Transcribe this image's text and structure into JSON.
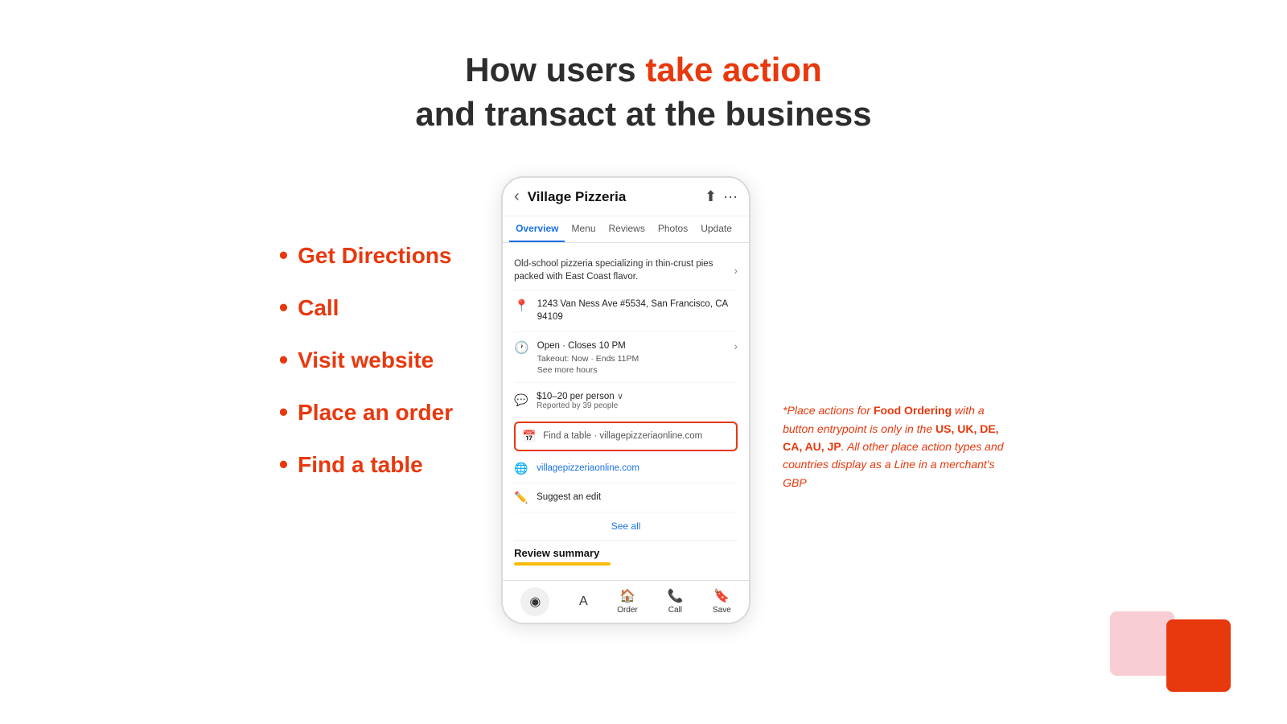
{
  "header": {
    "line1_normal": "How users ",
    "line1_accent": "take action",
    "line2": "and transact at the business"
  },
  "bullets": {
    "items": [
      {
        "label": "Get Directions"
      },
      {
        "label": "Call"
      },
      {
        "label": "Visit website"
      },
      {
        "label": "Place an order"
      },
      {
        "label": "Find a table"
      }
    ]
  },
  "phone": {
    "topbar": {
      "title": "Village Pizzeria",
      "back_icon": "‹",
      "share_icon": "⬆",
      "more_icon": "···"
    },
    "nav_tabs": [
      {
        "label": "Overview",
        "active": true
      },
      {
        "label": "Menu",
        "active": false
      },
      {
        "label": "Reviews",
        "active": false
      },
      {
        "label": "Photos",
        "active": false
      },
      {
        "label": "Update",
        "active": false
      }
    ],
    "description": "Old-school pizzeria specializing in thin-crust pies packed with East Coast flavor.",
    "address": "1243 Van Ness Ave #5534, San Francisco, CA 94109",
    "hours_main": "Open · Closes 10 PM",
    "hours_sub": "Takeout: Now · Ends 11PM",
    "hours_more": "See more hours",
    "price": "$10–20 per person",
    "price_dropdown": "∨",
    "price_reported": "Reported by 39 people",
    "find_table_label": "Find a table · ",
    "find_table_url": "villagepizzeriaonline.com",
    "website_url": "villagepizzeriaonline.com",
    "edit_label": "Suggest an edit",
    "see_all": "See all",
    "review_summary": "Review summary",
    "bottom_btns": [
      {
        "icon": "◉",
        "label": ""
      },
      {
        "icon": "A",
        "label": ""
      },
      {
        "icon": "🏠",
        "label": "Order"
      },
      {
        "icon": "📞",
        "label": "Call"
      },
      {
        "icon": "🔖",
        "label": "Save"
      }
    ]
  },
  "note": {
    "text_before": "*Place actions for ",
    "bold1": "Food Ordering",
    "text_mid": " with a button entrypoint is only in the ",
    "bold2": "US, UK, DE, CA, AU, JP",
    "text_end": ". All other place action types and countries display as a Line in a merchant's GBP"
  },
  "colors": {
    "accent": "#e8380d",
    "dark": "#2d2d2d",
    "blue": "#1a73e8"
  }
}
